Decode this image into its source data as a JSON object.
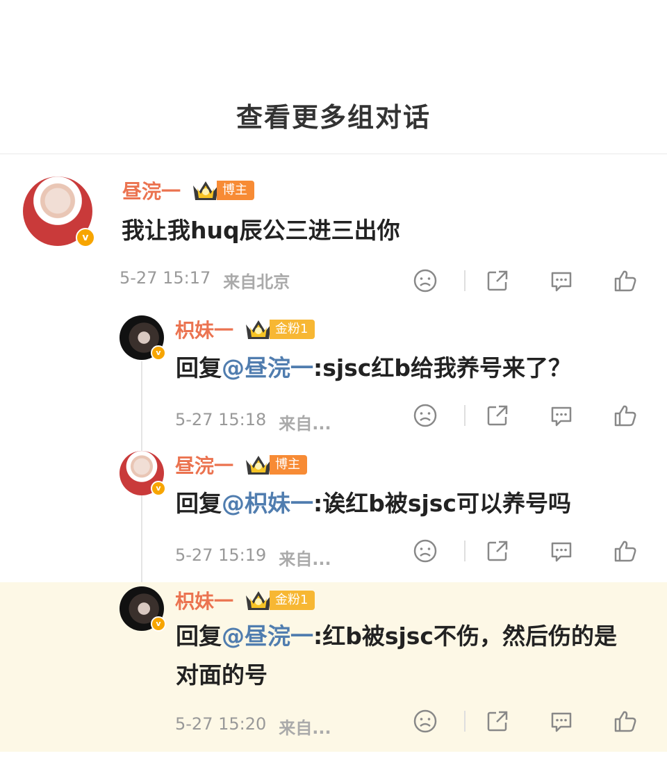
{
  "header": {
    "title": "查看更多组对话"
  },
  "comments": [
    {
      "name": "昼浣一",
      "tag": "博主",
      "text": "我让我huq辰公三进三出你",
      "time": "5-27 15:17",
      "location": "来自北京"
    },
    {
      "name": "枳妹一",
      "tag": "金粉1",
      "reply_prefix": "回复",
      "mention": "@昼浣一",
      "text": ":sjsc红b给我养号来了？",
      "time": "5-27 15:18",
      "location": "来自..."
    },
    {
      "name": "昼浣一",
      "tag": "博主",
      "reply_prefix": "回复",
      "mention": "@枳妹一",
      "text": ":诶红b被sjsc可以养号吗",
      "time": "5-27 15:19",
      "location": "来自..."
    },
    {
      "name": "枳妹一",
      "tag": "金粉1",
      "reply_prefix": "回复",
      "mention": "@昼浣一",
      "text": ":红b被sjsc不伤，然后伤的是对面的号",
      "time": "5-27 15:20",
      "location": "来自..."
    }
  ],
  "badge_letter": "v",
  "icons": [
    "frown-icon",
    "share-icon",
    "comment-icon",
    "like-icon",
    "crown-icon"
  ],
  "colors": {
    "name": "#eb7350",
    "mention": "#507daf",
    "highlight": "#fdf8e6",
    "tag_blogger": "#f78b35",
    "tag_gold": "#f7b733"
  }
}
